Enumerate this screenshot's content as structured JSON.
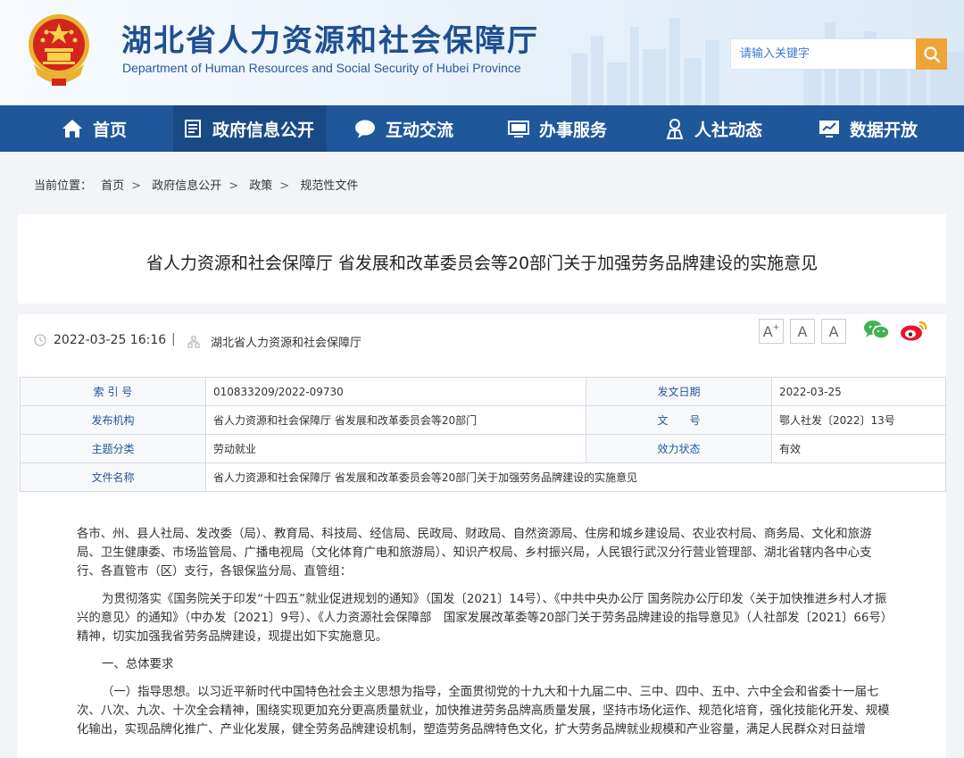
{
  "header": {
    "title": "湖北省人力资源和社会保障厅",
    "subtitle": "Department of Human Resources and Social Security of Hubei Province",
    "search_placeholder": "请输入关键字"
  },
  "nav": {
    "items": [
      {
        "label": "首页",
        "icon": "home-icon"
      },
      {
        "label": "政府信息公开",
        "icon": "document-list-icon",
        "active": true
      },
      {
        "label": "互动交流",
        "icon": "chat-bubble-icon"
      },
      {
        "label": "办事服务",
        "icon": "monitor-icon"
      },
      {
        "label": "人社动态",
        "icon": "person-icon"
      },
      {
        "label": "数据开放",
        "icon": "chart-screen-icon"
      }
    ]
  },
  "breadcrumb": {
    "prefix": "当前位置：",
    "items": [
      "首页",
      "政府信息公开",
      "政策",
      "规范性文件"
    ]
  },
  "article": {
    "title": "省人力资源和社会保障厅 省发展和改革委员会等20部门关于加强劳务品牌建设的实施意见",
    "date": "2022-03-25 16:16",
    "divider": "|",
    "source": "湖北省人力资源和社会保障厅",
    "font_buttons": [
      "A",
      "A",
      "A"
    ]
  },
  "info": {
    "index_label": "索 引 号",
    "index_value": "010833209/2022-09730",
    "issue_date_label": "发文日期",
    "issue_date_value": "2022-03-25",
    "publisher_label": "发布机构",
    "publisher_value": "省人力资源和社会保障厅 省发展和改革委员会等20部门",
    "doc_no_label": "文　　号",
    "doc_no_value": "鄂人社发〔2022〕13号",
    "topic_label": "主题分类",
    "topic_value": "劳动就业",
    "status_label": "效力状态",
    "status_value": "有效",
    "filename_label": "文件名称",
    "filename_value": "省人力资源和社会保障厅 省发展和改革委员会等20部门关于加强劳务品牌建设的实施意见"
  },
  "body": {
    "p1": "各市、州、县人社局、发改委（局）、教育局、科技局、经信局、民政局、财政局、自然资源局、住房和城乡建设局、农业农村局、商务局、文化和旅游局、卫生健康委、市场监管局、广播电视局（文化体育广电和旅游局）、知识产权局、乡村振兴局，人民银行武汉分行营业管理部、湖北省辖内各中心支行、各直管市（区）支行，各银保监分局、直管组：",
    "p2": "为贯彻落实《国务院关于印发“十四五”就业促进规划的通知》（国发〔2021〕14号）、《中共中央办公厅 国务院办公厅印发〈关于加快推进乡村人才振兴的意见〉的通知》（中办发〔2021〕9号）、《人力资源社会保障部　国家发展改革委等20部门关于劳务品牌建设的指导意见》（人社部发〔2021〕66号）精神，切实加强我省劳务品牌建设，现提出如下实施意见。",
    "p3": "一、总体要求",
    "p4": "（一）指导思想。以习近平新时代中国特色社会主义思想为指导，全面贯彻党的十九大和十九届二中、三中、四中、五中、六中全会和省委十一届七次、八次、九次、十次全会精神，围绕实现更加充分更高质量就业，加快推进劳务品牌高质量发展，坚持市场化运作、规范化培育，强化技能化开发、规模化输出，实现品牌化推广、产业化发展，健全劳务品牌建设机制，塑造劳务品牌特色文化，扩大劳务品牌就业规模和产业容量，满足人民群众对日益增"
  },
  "colors": {
    "nav_bg": "#20579a",
    "nav_active": "#1a4a86",
    "title_blue": "#1f4f8f",
    "search_btn": "#f0a437"
  }
}
